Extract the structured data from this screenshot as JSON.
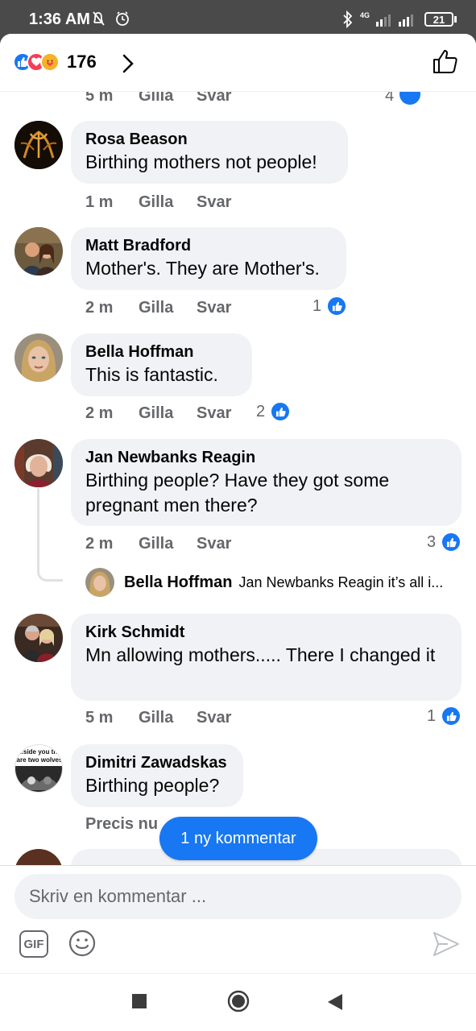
{
  "status_bar": {
    "time": "1:36 AM",
    "network": "4G",
    "battery": "21"
  },
  "header": {
    "reaction_count": "176",
    "reactions": [
      "like-icon",
      "love-icon",
      "care-icon"
    ]
  },
  "peek": {
    "time": "5 m",
    "like": "Gilla",
    "reply": "Svar",
    "count": "4"
  },
  "comments": [
    {
      "author": "Rosa Beason",
      "text": "Birthing mothers not people!",
      "time": "1 m",
      "like": "Gilla",
      "reply": "Svar",
      "likes": ""
    },
    {
      "author": "Matt Bradford",
      "text": "Mother's. They are Mother's.",
      "time": "2 m",
      "like": "Gilla",
      "reply": "Svar",
      "likes": "1"
    },
    {
      "author": "Bella Hoffman",
      "text": "This is fantastic.",
      "time": "2 m",
      "like": "Gilla",
      "reply": "Svar",
      "likes": "2"
    },
    {
      "author": "Jan Newbanks Reagin",
      "text": "Birthing people?  Have they got some pregnant men there?",
      "time": "2 m",
      "like": "Gilla",
      "reply": "Svar",
      "likes": "3"
    },
    {
      "author": "Kirk Schmidt",
      "text": "Mn allowing mothers..... There I changed it",
      "time": "5 m",
      "like": "Gilla",
      "reply": "Svar",
      "likes": "1"
    },
    {
      "author": "Dimitri Zawadskas",
      "text": "Birthing people?",
      "time": "Precis nu",
      "like": "",
      "reply": "",
      "likes": ""
    }
  ],
  "reply_preview": {
    "author": "Bella Hoffman",
    "text": "Jan Newbanks Reagin it’s all i..."
  },
  "avatar_caption": {
    "line1": "...side you the",
    "line2": "are two wolves"
  },
  "new_comment_pill": "1 ny kommentar",
  "composer": {
    "placeholder": "Skriv en kommentar ...",
    "gif_label": "GIF"
  },
  "colors": {
    "accent": "#1877f2",
    "bubble": "#f0f2f5",
    "secondary_text": "#65676b",
    "love": "#f33e58",
    "care": "#f7b125"
  }
}
